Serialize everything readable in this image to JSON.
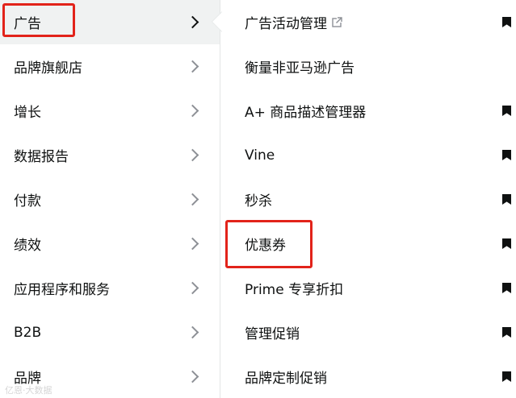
{
  "left_menu": {
    "items": [
      {
        "label": "广告",
        "active": true
      },
      {
        "label": "品牌旗舰店"
      },
      {
        "label": "增长"
      },
      {
        "label": "数据报告"
      },
      {
        "label": "付款"
      },
      {
        "label": "绩效"
      },
      {
        "label": "应用程序和服务"
      },
      {
        "label": "B2B"
      },
      {
        "label": "品牌"
      }
    ]
  },
  "submenu": {
    "items": [
      {
        "label": "广告活动管理",
        "external_icon": "external-link-icon",
        "bookmark": true
      },
      {
        "label": "衡量非亚马逊广告",
        "bookmark": false
      },
      {
        "label": "A+ 商品描述管理器",
        "bookmark": true
      },
      {
        "label": "Vine",
        "bookmark": true
      },
      {
        "label": "秒杀",
        "bookmark": true
      },
      {
        "label": "优惠券",
        "bookmark": true
      },
      {
        "label": "Prime 专享折扣",
        "bookmark": true
      },
      {
        "label": "管理促销",
        "bookmark": true
      },
      {
        "label": "品牌定制促销",
        "bookmark": true
      }
    ]
  },
  "annotations": {
    "highlight_color": "#e2231a"
  },
  "watermark": {
    "text": "亿恩·大数据"
  },
  "colors": {
    "text": "#0f1111",
    "chevron": "#8d9096",
    "active_bg": "#f0f2f2"
  }
}
